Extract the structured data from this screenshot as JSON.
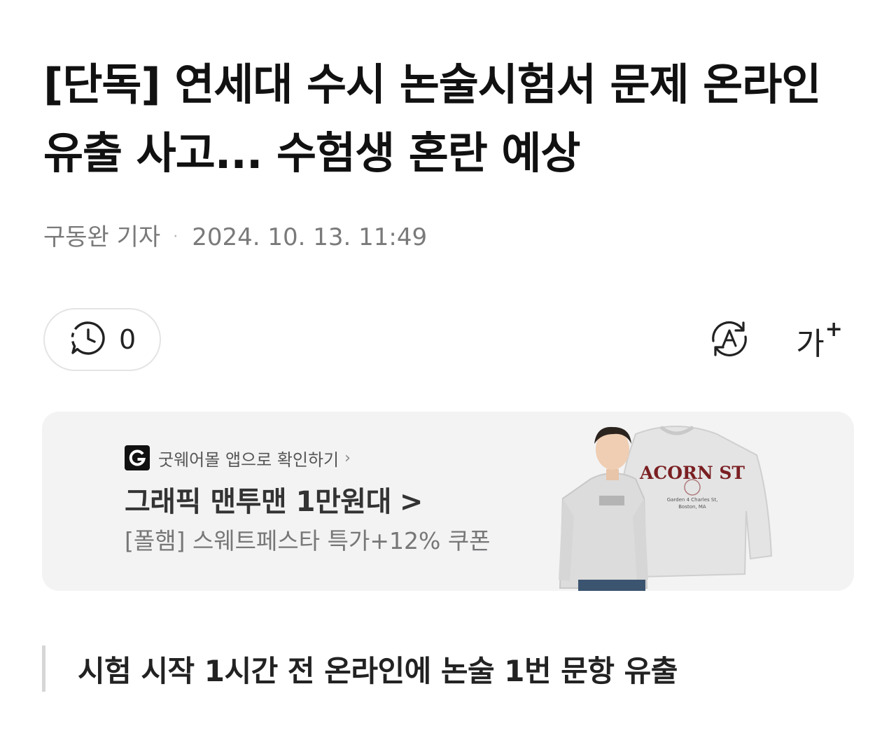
{
  "article": {
    "headline": "[단독] 연세대 수시 논술시험서 문제 온라인 유출 사고... 수험생 혼란 예상",
    "reporter": "구동완 기자",
    "separator": "·",
    "datetime": "2024. 10. 13. 11:49",
    "section_heading": "시험 시작 1시간 전 온라인에 논술 1번 문항 유출"
  },
  "toolbar": {
    "comment_icon": "comment-clock-icon",
    "comment_count": "0",
    "translate_icon": "translate-icon",
    "font_size_glyph": "가",
    "font_size_plus": "+"
  },
  "ad": {
    "source_logo_letter": "G",
    "source_text": "굿웨어몰 앱으로 확인하기",
    "source_chevron": "›",
    "title": "그래픽 맨투맨 1만원대",
    "title_arrow": ">",
    "subtitle": "[폴햄] 스웨트페스타 특가+12% 쿠폰",
    "product_print_title": "ACORN ST",
    "product_print_sub1": "Garden 4 Charles St,",
    "product_print_sub2": "Boston, MA",
    "brand_color": "#111111"
  }
}
